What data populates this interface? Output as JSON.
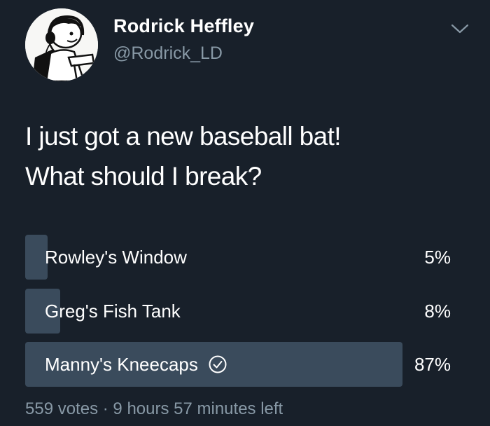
{
  "user": {
    "display_name": "Rodrick Heffley",
    "handle": "@Rodrick_LD",
    "avatar_icon": "cartoon-avatar-with-headphones"
  },
  "tweet": {
    "lines": [
      "I just got a new baseball bat!",
      "What should I break?"
    ]
  },
  "poll": {
    "options": [
      {
        "label": "Rowley's Window",
        "percent_label": "5%",
        "percent": 5,
        "selected": false
      },
      {
        "label": "Greg's Fish Tank",
        "percent_label": "8%",
        "percent": 8,
        "selected": false
      },
      {
        "label": "Manny's Kneecaps",
        "percent_label": "87%",
        "percent": 87,
        "selected": true
      }
    ],
    "votes": "559 votes",
    "separator": "·",
    "time_left": "9 hours 57 minutes left"
  },
  "colors": {
    "background": "#18202a",
    "bar_fill": "#3a4b5c",
    "secondary_text": "#8899a6"
  }
}
